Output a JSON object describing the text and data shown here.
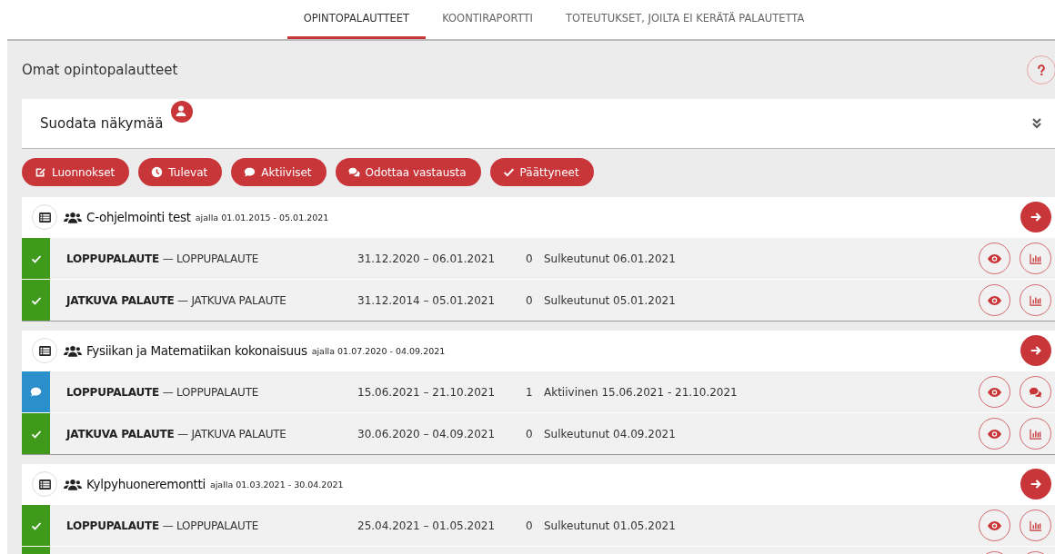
{
  "tabs": [
    {
      "label": "OPINTOPALAUTTEET",
      "selected": true
    },
    {
      "label": "KOONTIRAPORTTI",
      "selected": false
    },
    {
      "label": "TOTEUTUKSET, JOILTA EI KERÄTÄ PALAUTETTA",
      "selected": false
    }
  ],
  "page_title": "Omat opintopalautteet",
  "filter_panel": {
    "title": "Suodata näkymää",
    "expanded": false
  },
  "filter_buttons": [
    {
      "kind": "drafts",
      "label": "Luonnokset"
    },
    {
      "kind": "upcoming",
      "label": "Tulevat"
    },
    {
      "kind": "active",
      "label": "Aktiiviset"
    },
    {
      "kind": "waiting",
      "label": "Odottaa vastausta"
    },
    {
      "kind": "ended",
      "label": "Päättyneet"
    }
  ],
  "groups": [
    {
      "title": "C-ohjelmointi test",
      "period": "ajalla 01.01.2015 - 05.01.2021",
      "rows": [
        {
          "kind": "closed",
          "name": "**LOPPUPALAUTE** — LOPPUPALAUTE",
          "dates": "31.12.2020 – 06.01.2021",
          "count": "0",
          "state_text": "Sulkeutunut 06.01.2021"
        },
        {
          "kind": "closed",
          "name": "**JATKUVA PALAUTE** — JATKUVA PALAUTE",
          "dates": "31.12.2014 – 05.01.2021",
          "count": "0",
          "state_text": "Sulkeutunut 05.01.2021"
        }
      ]
    },
    {
      "title": "Fysiikan ja Matematiikan kokonaisuus",
      "period": "ajalla 01.07.2020 - 04.09.2021",
      "rows": [
        {
          "kind": "active",
          "name": "**LOPPUPALAUTE** — LOPPUPALAUTE",
          "dates": "15.06.2021 – 21.10.2021",
          "count": "1",
          "state_text": "Aktiivinen 15.06.2021 - 21.10.2021"
        },
        {
          "kind": "closed",
          "name": "**JATKUVA PALAUTE** — JATKUVA PALAUTE",
          "dates": "30.06.2020 – 04.09.2021",
          "count": "0",
          "state_text": "Sulkeutunut 04.09.2021"
        }
      ]
    },
    {
      "title": "Kylpyhuoneremontti",
      "period": "ajalla 01.03.2021 - 30.04.2021",
      "rows": [
        {
          "kind": "closed",
          "name": "**LOPPUPALAUTE** — LOPPUPALAUTE",
          "dates": "25.04.2021 – 01.05.2021",
          "count": "0",
          "state_text": "Sulkeutunut 01.05.2021"
        },
        {
          "kind": "closed"
        }
      ]
    }
  ]
}
